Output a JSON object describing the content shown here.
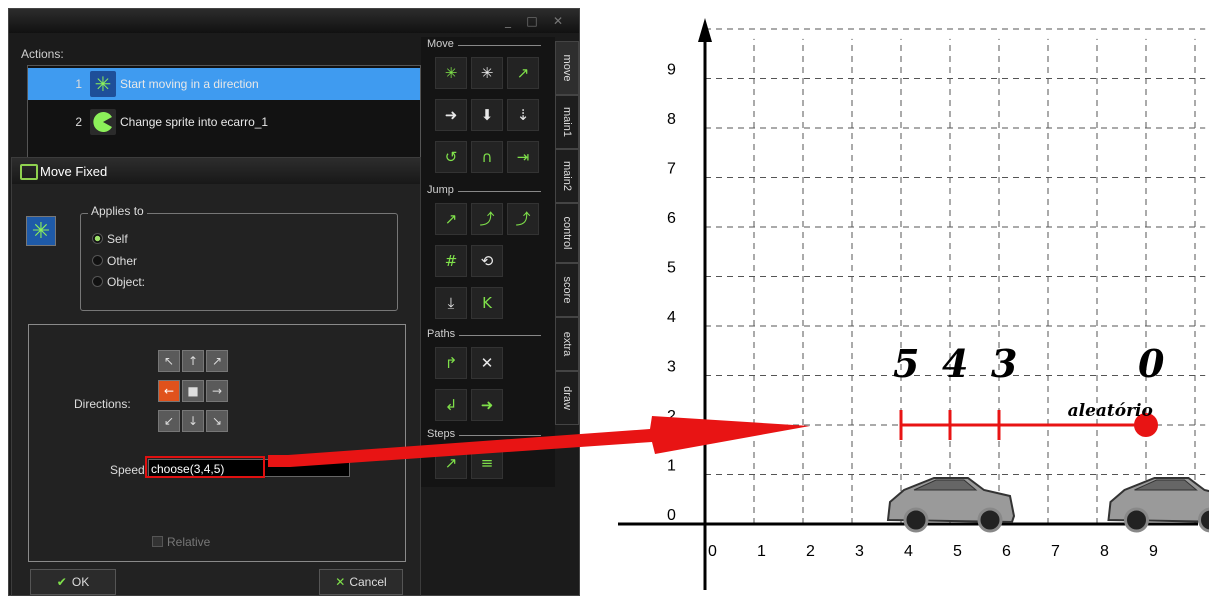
{
  "window": {
    "controls": [
      "_",
      "□",
      "✕"
    ]
  },
  "actions": {
    "label": "Actions:",
    "items": [
      {
        "num": "1",
        "text": "Start moving in a direction",
        "icon": "move-fixed-icon"
      },
      {
        "num": "2",
        "text": "Change sprite into ecarro_1",
        "icon": "change-sprite-icon"
      }
    ]
  },
  "dialog": {
    "title": "Move Fixed",
    "applies_to": {
      "label": "Applies to",
      "options": [
        "Self",
        "Other",
        "Object:"
      ],
      "selected": "Self"
    },
    "directions_label": "Directions:",
    "selected_direction": "left",
    "speed_label": "Speed:",
    "speed_value": "choose(3,4,5)",
    "relative_label": "Relative",
    "ok_label": "OK",
    "cancel_label": "Cancel"
  },
  "palette": {
    "sections": [
      "Move",
      "Jump",
      "Paths",
      "Steps"
    ],
    "tabs": [
      "move",
      "main1",
      "main2",
      "control",
      "score",
      "extra",
      "draw"
    ],
    "active_tab": "move"
  },
  "chart_data": {
    "type": "line",
    "x_ticks": [
      "0",
      "1",
      "2",
      "3",
      "4",
      "5",
      "6",
      "7",
      "8",
      "9"
    ],
    "y_ticks": [
      "0",
      "1",
      "2",
      "3",
      "4",
      "5",
      "6",
      "7",
      "8",
      "9"
    ],
    "xlim": [
      0,
      9.8
    ],
    "ylim": [
      0,
      9.8
    ],
    "grid": true,
    "segment": {
      "y": 2,
      "x_start": 4,
      "x_end": 9
    },
    "tick_marks": [
      4,
      5,
      6
    ],
    "endpoint": 9,
    "labels": [
      {
        "text": "5",
        "x": 4
      },
      {
        "text": "4",
        "x": 5
      },
      {
        "text": "3",
        "x": 6
      },
      {
        "text": "0",
        "x": 9
      }
    ],
    "annotation": "aleatório",
    "cars_at_x": [
      5,
      9.5
    ]
  }
}
